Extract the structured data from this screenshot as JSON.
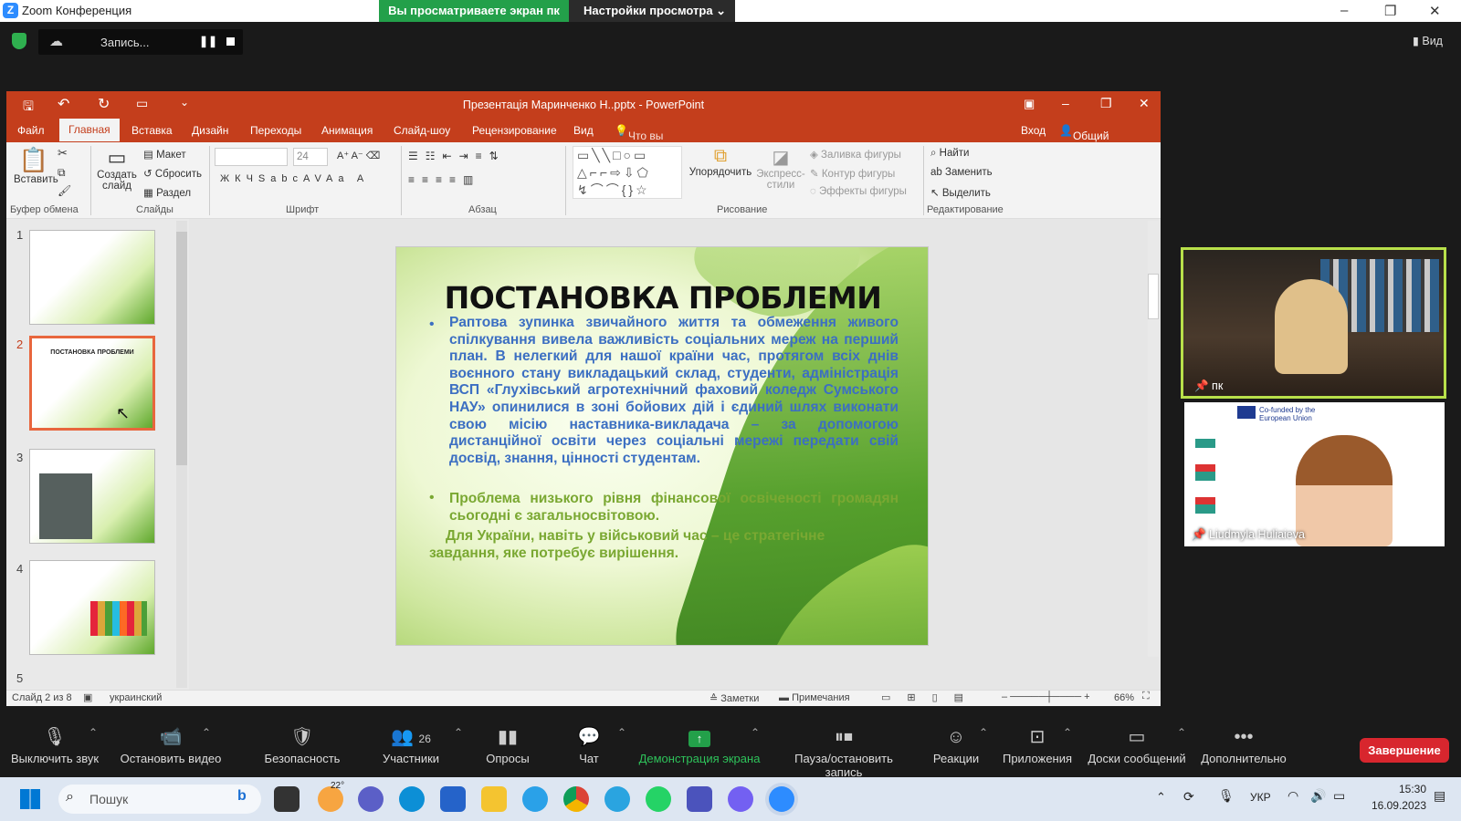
{
  "zoom": {
    "window_title": "Zoom Конференция",
    "share_banner": "Вы просматриваете экран пк",
    "view_options": "Настройки просмотра",
    "recording_label": "Запись...",
    "view_button": "Вид"
  },
  "ppt": {
    "title": "Презентація Маринченко Н..pptx - PowerPoint",
    "tabs": [
      "Файл",
      "Главная",
      "Вставка",
      "Дизайн",
      "Переходы",
      "Анимация",
      "Слайд-шоу",
      "Рецензирование",
      "Вид"
    ],
    "tell_me": "Что вы хотите сделать?",
    "sign_in": "Вход",
    "share": "Общий доступ",
    "ribbon": {
      "paste": "Вставить",
      "clipboard_group": "Буфер обмена",
      "new_slide": "Создать слайд",
      "layout": "Макет",
      "reset": "Сбросить",
      "section": "Раздел",
      "slides_group": "Слайды",
      "font_size": "24",
      "font_group": "Шрифт",
      "paragraph_group": "Абзац",
      "arrange": "Упорядочить",
      "quick_styles": "Экспресс-стили",
      "shape_fill": "Заливка фигуры",
      "shape_outline": "Контур фигуры",
      "shape_effects": "Эффекты фигуры",
      "drawing_group": "Рисование",
      "find": "Найти",
      "replace": "Заменить",
      "select": "Выделить",
      "editing_group": "Редактирование"
    },
    "thumb_numbers": [
      "1",
      "2",
      "3",
      "4",
      "5"
    ],
    "thumb2_title": "ПОСТАНОВКА ПРОБЛЕМИ",
    "slide": {
      "heading": "ПОСТАНОВКА ПРОБЛЕМИ",
      "bullet1": "Раптова зупинка звичайного життя та обмеження живого спілкування вивела важливість соціальних мереж на перший план. В нелегкий для нашої країни час, протягом всіх днів воєнного стану викладацький склад, студенти, адміністрація ВСП «Глухівський агротехнічний фаховий коледж Сумського НАУ» опинилися в зоні бойових дій і єдиний шлях виконати свою місію наставника-викладача – за допомогою дистанційної освіти через соціальні мережі передати свій досвід, знання, цінності студентам.",
      "bullet2": "Проблема низького рівня фінансової освіченості громадян сьогодні є загальносвітовою.",
      "para3": "Для України, навіть у військовий час – це стратегічне завдання, яке потребує вирішення."
    },
    "status": {
      "slide_of": "Слайд 2 из 8",
      "language": "украинский",
      "notes": "Заметки",
      "comments": "Примечания",
      "zoom": "66%"
    }
  },
  "videos": [
    {
      "name": "пк"
    },
    {
      "name": "Liudmyla Huliaieva",
      "banner": "Co-funded by the European Union"
    }
  ],
  "toolbar": {
    "mute": "Выключить звук",
    "video": "Остановить видео",
    "security": "Безопасность",
    "participants": "Участники",
    "participants_count": "26",
    "polls": "Опросы",
    "chat": "Чат",
    "share": "Демонстрация экрана",
    "pause_rec": "Пауза/остановить запись",
    "reactions": "Реакции",
    "apps": "Приложения",
    "whiteboards": "Доски сообщений",
    "more": "Дополнительно",
    "end": "Завершение"
  },
  "taskbar": {
    "search": "Пошук",
    "weather": "22°",
    "lang": "УКР",
    "time": "15:30",
    "date": "16.09.2023"
  },
  "colors": {
    "ppt_accent": "#c43e1c",
    "zoom_green": "#23a04a",
    "end_red": "#d8262e"
  }
}
